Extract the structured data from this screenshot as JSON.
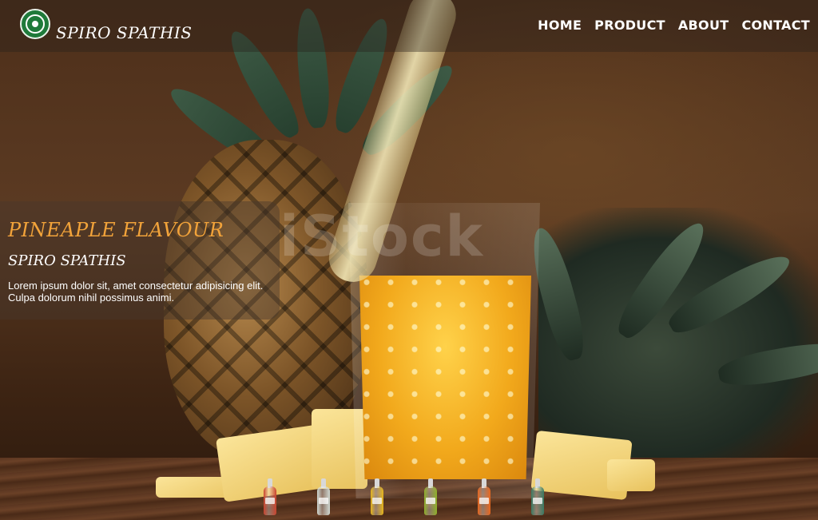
{
  "header": {
    "brand": "SPIRO SPATHIS",
    "nav": [
      {
        "label": "HOME"
      },
      {
        "label": "PRODUCT"
      },
      {
        "label": "ABOUT"
      },
      {
        "label": "CONTACT"
      }
    ]
  },
  "hero": {
    "flavour": "PINEAPLE FLAVOUR",
    "maker": "SPIRO SPATHIS",
    "description": "Lorem ipsum dolor sit, amet consectetur adipisicing elit. Culpa dolorum nihil possimus animi."
  },
  "watermark": "iStock",
  "bottles": [
    {
      "name": "bottle-red",
      "color": "#c9442e"
    },
    {
      "name": "bottle-clear",
      "color": "#cfd8d2"
    },
    {
      "name": "bottle-yellow",
      "color": "#e5b51c"
    },
    {
      "name": "bottle-green",
      "color": "#8fb02a"
    },
    {
      "name": "bottle-orange",
      "color": "#e8661d"
    },
    {
      "name": "bottle-teal",
      "color": "#3a7a62"
    }
  ],
  "colors": {
    "accent": "#f2a33a",
    "logo_green": "#1f7a3a"
  }
}
